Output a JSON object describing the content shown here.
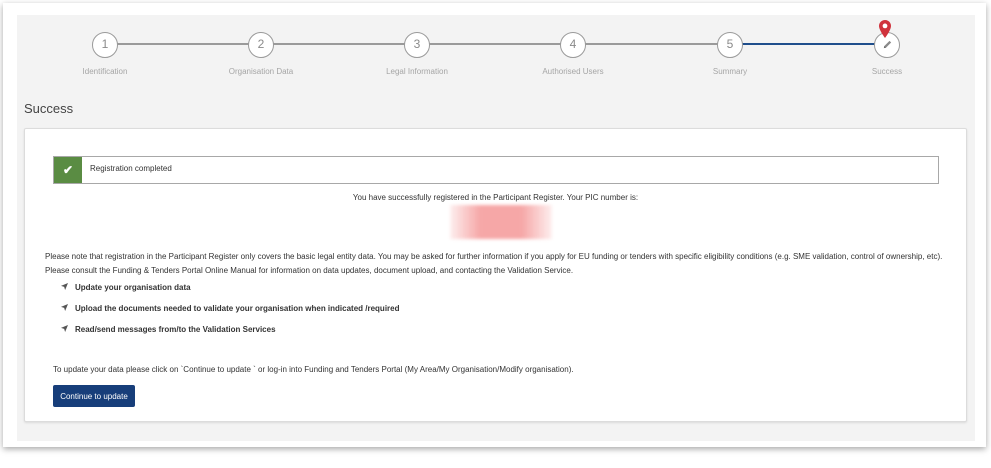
{
  "stepper": {
    "steps": [
      {
        "number": "1",
        "label": "Identification"
      },
      {
        "number": "2",
        "label": "Organisation Data"
      },
      {
        "number": "3",
        "label": "Legal Information"
      },
      {
        "number": "4",
        "label": "Authorised Users"
      },
      {
        "number": "5",
        "label": "Summary"
      },
      {
        "number": "",
        "label": "Success"
      }
    ],
    "current_icon": "pencil-icon",
    "marker_icon": "location-pin-icon",
    "colors": {
      "active_line": "#1f4e8c",
      "pin": "#d0323c"
    }
  },
  "page": {
    "title": "Success"
  },
  "alert": {
    "icon": "check-icon",
    "text": "Registration completed",
    "color": "#5a8c43"
  },
  "registration": {
    "pic_intro": "You have successfully registered in the Participant Register. Your PIC number is:"
  },
  "note": {
    "text": "Please note that registration in the Participant Register only covers the basic legal entity data. You may be asked for further information if you apply for EU funding or tenders with specific eligibility conditions (e.g. SME validation, control of ownership, etc). Please consult the Funding & Tenders Portal Online Manual for information on data updates, document upload, and contacting the Validation Service."
  },
  "features": [
    {
      "icon": "arrow-icon",
      "text": "Update your organisation data"
    },
    {
      "icon": "arrow-icon",
      "text": "Upload the documents needed to validate your organisation when indicated /required"
    },
    {
      "icon": "arrow-icon",
      "text": "Read/send messages from/to the Validation Services"
    }
  ],
  "update": {
    "text": "To update your data please click on `Continue to update ` or log-in into Funding and Tenders Portal (My Area/My Organisation/Modify organisation).",
    "button_label": "Continue to update",
    "button_color": "#173e7a"
  }
}
